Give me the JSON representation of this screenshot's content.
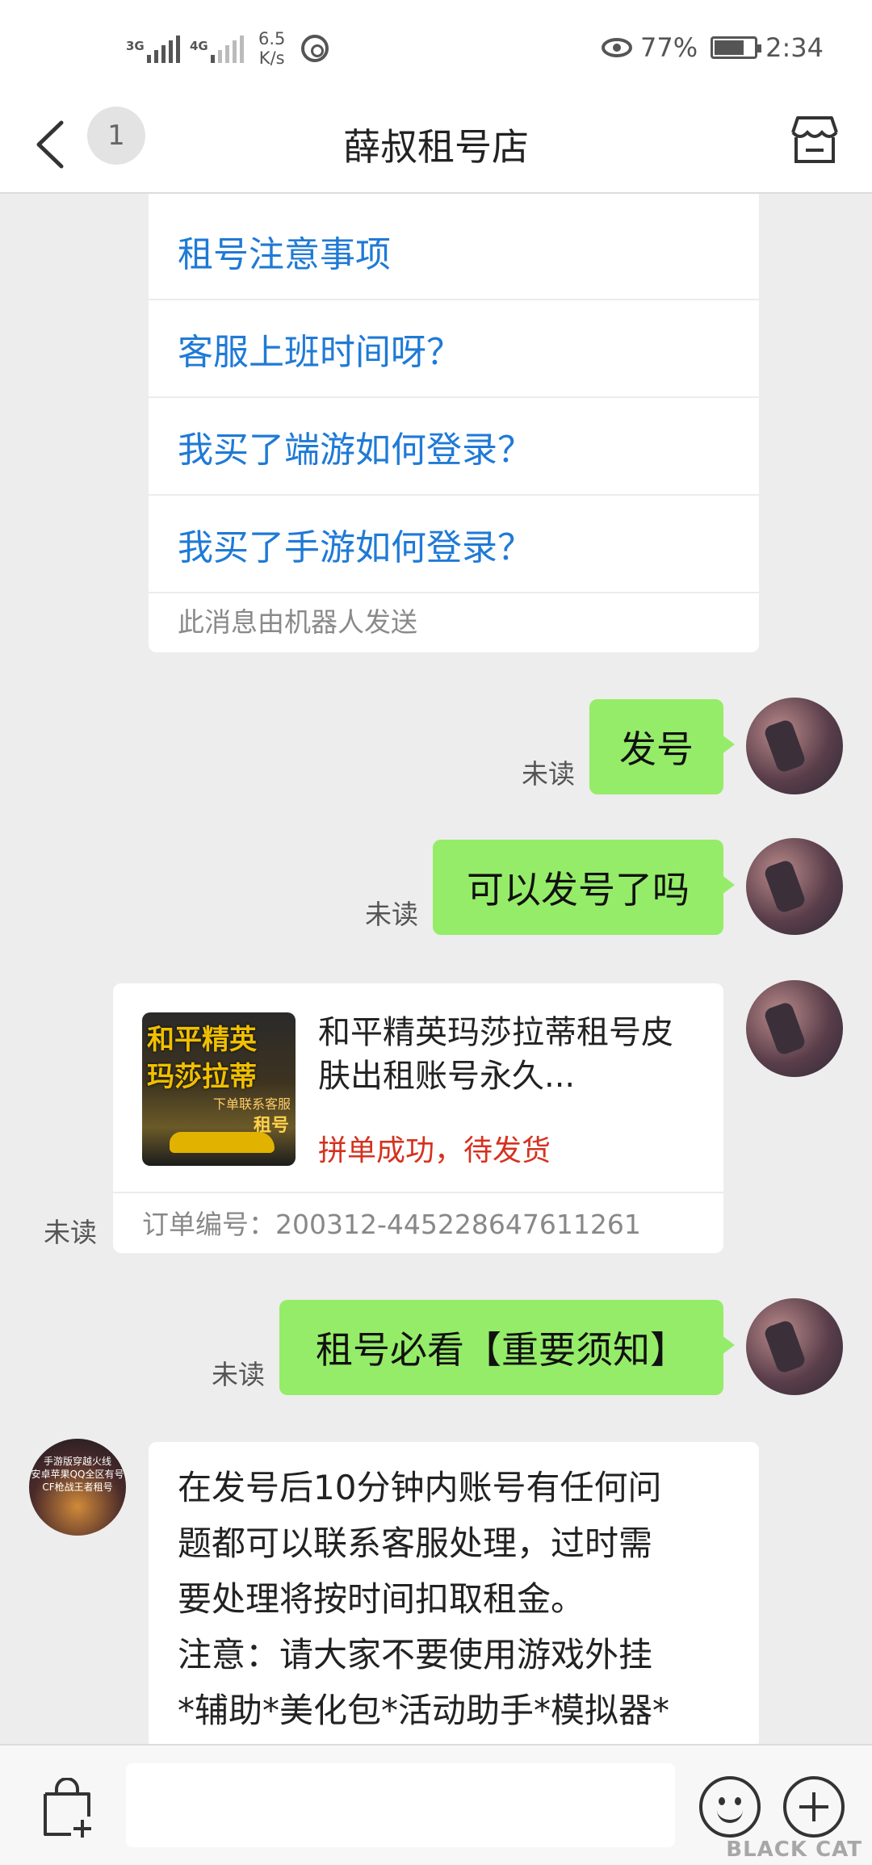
{
  "status_bar": {
    "net1": "3G",
    "net2": "4G",
    "speed_value": "6.5",
    "speed_unit": "K/s",
    "battery": "77%",
    "battery_level": 0.77,
    "time": "2:34"
  },
  "nav": {
    "unread_count": "1",
    "title": "薛叔租号店"
  },
  "robot_menu": {
    "items": [
      "租号注意事项",
      "客服上班时间呀？",
      "我买了端游如何登录？",
      "我买了手游如何登录？"
    ],
    "footer": "此消息由机器人发送"
  },
  "messages": {
    "m1": {
      "text": "发号",
      "status": "未读"
    },
    "m2": {
      "text": "可以发号了吗",
      "status": "未读"
    },
    "product": {
      "thumb_line1": "和平精英",
      "thumb_line2": "玛莎拉蒂",
      "thumb_line3": "下单联系客服",
      "thumb_line4": "租号",
      "title": "和平精英玛莎拉蒂租号皮肤出租账号永久...",
      "status": "拼单成功，待发货",
      "order_label": "订单编号：200312-445228647611261",
      "read_status": "未读"
    },
    "m3": {
      "text": "租号必看【重要须知】",
      "status": "未读"
    },
    "shop_reply": {
      "line1": "在发号后10分钟内账号有任何问",
      "line2": "题都可以联系客服处理，过时需",
      "line3": "要处理将按时间扣取租金。",
      "line4": "注意：请大家不要使用游戏外挂",
      "line5": "*辅助*美化包*活动助手*模拟器*"
    },
    "shop_avatar_text": [
      "手游版穿越火线",
      "安卓苹果QQ全区有号",
      "CF枪战王者租号"
    ]
  },
  "watermark": "BLACK CAT",
  "colors": {
    "link_blue": "#1f7ad6",
    "bubble_green": "#95ec69",
    "status_red": "#d4321f"
  },
  "icons": [
    "back-icon",
    "store-icon",
    "bag-plus-icon",
    "emoji-icon",
    "plus-icon"
  ]
}
